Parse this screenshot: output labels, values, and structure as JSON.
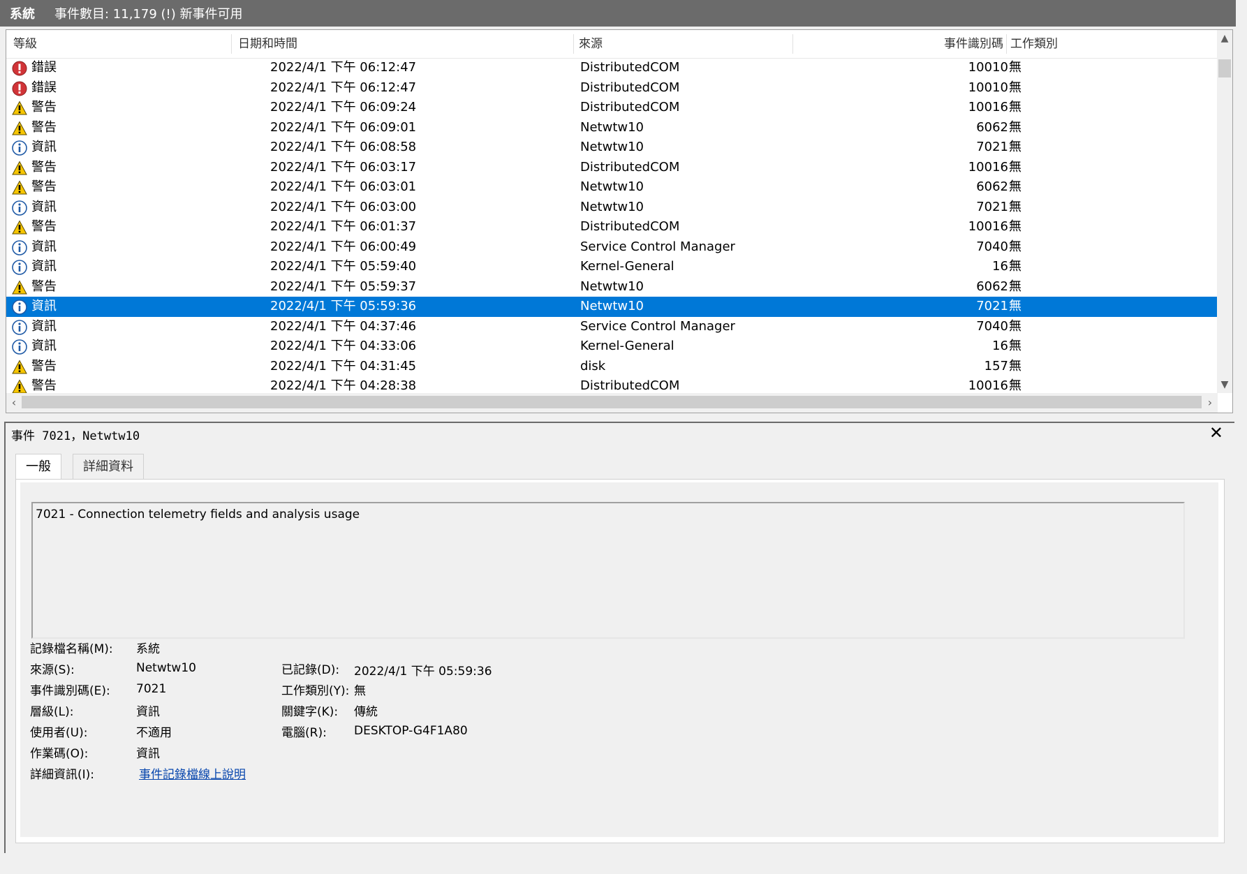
{
  "titlebar": {
    "log_name": "系統",
    "event_count": "事件數目: 11,179 (!) 新事件可用"
  },
  "columns": {
    "level": "等級",
    "datetime": "日期和時間",
    "source": "來源",
    "event_id": "事件識別碼",
    "category": "工作類別"
  },
  "events": [
    {
      "level": "錯誤",
      "type": "error",
      "datetime": "2022/4/1 下午 06:12:47",
      "source": "DistributedCOM",
      "event_id": "10010",
      "category": "無"
    },
    {
      "level": "錯誤",
      "type": "error",
      "datetime": "2022/4/1 下午 06:12:47",
      "source": "DistributedCOM",
      "event_id": "10010",
      "category": "無"
    },
    {
      "level": "警告",
      "type": "warning",
      "datetime": "2022/4/1 下午 06:09:24",
      "source": "DistributedCOM",
      "event_id": "10016",
      "category": "無"
    },
    {
      "level": "警告",
      "type": "warning",
      "datetime": "2022/4/1 下午 06:09:01",
      "source": "Netwtw10",
      "event_id": "6062",
      "category": "無"
    },
    {
      "level": "資訊",
      "type": "info",
      "datetime": "2022/4/1 下午 06:08:58",
      "source": "Netwtw10",
      "event_id": "7021",
      "category": "無"
    },
    {
      "level": "警告",
      "type": "warning",
      "datetime": "2022/4/1 下午 06:03:17",
      "source": "DistributedCOM",
      "event_id": "10016",
      "category": "無"
    },
    {
      "level": "警告",
      "type": "warning",
      "datetime": "2022/4/1 下午 06:03:01",
      "source": "Netwtw10",
      "event_id": "6062",
      "category": "無"
    },
    {
      "level": "資訊",
      "type": "info",
      "datetime": "2022/4/1 下午 06:03:00",
      "source": "Netwtw10",
      "event_id": "7021",
      "category": "無"
    },
    {
      "level": "警告",
      "type": "warning",
      "datetime": "2022/4/1 下午 06:01:37",
      "source": "DistributedCOM",
      "event_id": "10016",
      "category": "無"
    },
    {
      "level": "資訊",
      "type": "info",
      "datetime": "2022/4/1 下午 06:00:49",
      "source": "Service Control Manager",
      "event_id": "7040",
      "category": "無"
    },
    {
      "level": "資訊",
      "type": "info",
      "datetime": "2022/4/1 下午 05:59:40",
      "source": "Kernel-General",
      "event_id": "16",
      "category": "無"
    },
    {
      "level": "警告",
      "type": "warning",
      "datetime": "2022/4/1 下午 05:59:37",
      "source": "Netwtw10",
      "event_id": "6062",
      "category": "無"
    },
    {
      "level": "資訊",
      "type": "info",
      "datetime": "2022/4/1 下午 05:59:36",
      "source": "Netwtw10",
      "event_id": "7021",
      "category": "無",
      "selected": true
    },
    {
      "level": "資訊",
      "type": "info",
      "datetime": "2022/4/1 下午 04:37:46",
      "source": "Service Control Manager",
      "event_id": "7040",
      "category": "無"
    },
    {
      "level": "資訊",
      "type": "info",
      "datetime": "2022/4/1 下午 04:33:06",
      "source": "Kernel-General",
      "event_id": "16",
      "category": "無"
    },
    {
      "level": "警告",
      "type": "warning",
      "datetime": "2022/4/1 下午 04:31:45",
      "source": "disk",
      "event_id": "157",
      "category": "無"
    },
    {
      "level": "警告",
      "type": "warning",
      "datetime": "2022/4/1 下午 04:28:38",
      "source": "DistributedCOM",
      "event_id": "10016",
      "category": "無"
    }
  ],
  "detail": {
    "header": "事件 7021，Netwtw10",
    "close": "✕",
    "tabs": {
      "general": "一般",
      "details": "詳細資料"
    },
    "description": "7021 - Connection telemetry fields and analysis usage",
    "labels": {
      "log_name": "記錄檔名稱(M):",
      "source": "來源(S):",
      "event_id": "事件識別碼(E):",
      "level": "層級(L):",
      "user": "使用者(U):",
      "opcode": "作業碼(O):",
      "more_info": "詳細資訊(I):",
      "logged": "已記錄(D):",
      "task_category": "工作類別(Y):",
      "keywords": "關鍵字(K):",
      "computer": "電腦(R):"
    },
    "values": {
      "log_name": "系統",
      "source": "Netwtw10",
      "event_id": "7021",
      "level": "資訊",
      "user": "不適用",
      "opcode": "資訊",
      "more_info": "事件記錄檔線上說明",
      "logged": "2022/4/1 下午 05:59:36",
      "task_category": "無",
      "keywords": "傳統",
      "computer": "DESKTOP-G4F1A80"
    }
  },
  "colors": {
    "selected": "#0078d7",
    "error": "#d13438",
    "warning": "#f7c600",
    "info": "#1f5aa6",
    "titlebar": "#6b6b6b"
  },
  "icons": {
    "error": "error-icon",
    "warning": "warning-icon",
    "info": "info-icon"
  }
}
